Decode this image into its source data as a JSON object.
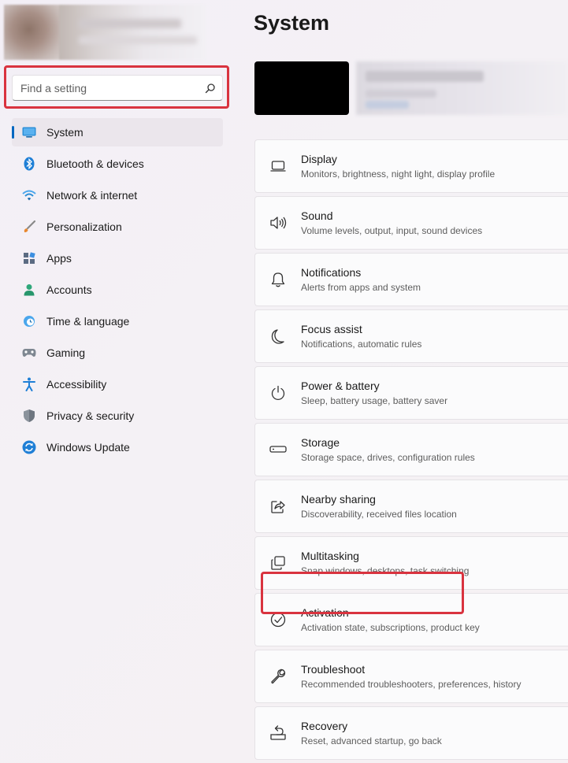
{
  "sidebar": {
    "search": {
      "placeholder": "Find a setting",
      "value": ""
    },
    "items": [
      {
        "label": "System",
        "icon": "monitor-icon",
        "active": true
      },
      {
        "label": "Bluetooth & devices",
        "icon": "bluetooth-icon"
      },
      {
        "label": "Network & internet",
        "icon": "wifi-icon"
      },
      {
        "label": "Personalization",
        "icon": "brush-icon"
      },
      {
        "label": "Apps",
        "icon": "apps-icon"
      },
      {
        "label": "Accounts",
        "icon": "person-icon"
      },
      {
        "label": "Time & language",
        "icon": "clock-globe-icon"
      },
      {
        "label": "Gaming",
        "icon": "gamepad-icon"
      },
      {
        "label": "Accessibility",
        "icon": "accessibility-icon"
      },
      {
        "label": "Privacy & security",
        "icon": "shield-icon"
      },
      {
        "label": "Windows Update",
        "icon": "update-icon"
      }
    ]
  },
  "main": {
    "title": "System",
    "settings": [
      {
        "title": "Display",
        "subtitle": "Monitors, brightness, night light, display profile",
        "icon": "display-icon"
      },
      {
        "title": "Sound",
        "subtitle": "Volume levels, output, input, sound devices",
        "icon": "speaker-icon"
      },
      {
        "title": "Notifications",
        "subtitle": "Alerts from apps and system",
        "icon": "bell-icon"
      },
      {
        "title": "Focus assist",
        "subtitle": "Notifications, automatic rules",
        "icon": "moon-icon"
      },
      {
        "title": "Power & battery",
        "subtitle": "Sleep, battery usage, battery saver",
        "icon": "power-icon"
      },
      {
        "title": "Storage",
        "subtitle": "Storage space, drives, configuration rules",
        "icon": "drive-icon"
      },
      {
        "title": "Nearby sharing",
        "subtitle": "Discoverability, received files location",
        "icon": "share-icon"
      },
      {
        "title": "Multitasking",
        "subtitle": "Snap windows, desktops, task switching",
        "icon": "multitask-icon"
      },
      {
        "title": "Activation",
        "subtitle": "Activation state, subscriptions, product key",
        "icon": "check-circle-icon"
      },
      {
        "title": "Troubleshoot",
        "subtitle": "Recommended troubleshooters, preferences, history",
        "icon": "wrench-icon"
      },
      {
        "title": "Recovery",
        "subtitle": "Reset, advanced startup, go back",
        "icon": "recovery-icon"
      }
    ]
  },
  "colors": {
    "accent": "#0067c0",
    "highlight": "#d9333f"
  }
}
